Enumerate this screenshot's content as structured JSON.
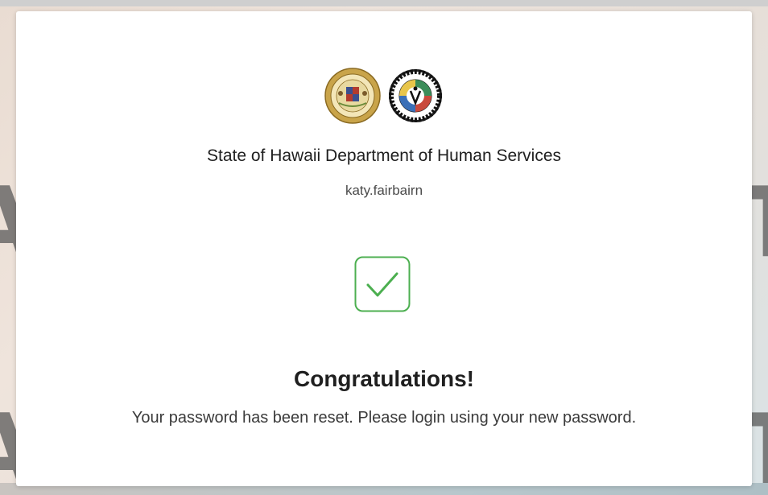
{
  "header": {
    "org_title": "State of Hawaii Department of Human Services",
    "username": "katy.fairbairn",
    "logos": {
      "seal_icon": "state-of-hawaii-seal",
      "dhs_icon": "department-of-human-services-logo"
    }
  },
  "status": {
    "icon": "check-icon",
    "icon_color": "#4caf50",
    "heading": "Congratulations!",
    "message": "Your password has been reset. Please login using your new password."
  },
  "background": {
    "letter_left": "A",
    "letter_right": "T"
  }
}
